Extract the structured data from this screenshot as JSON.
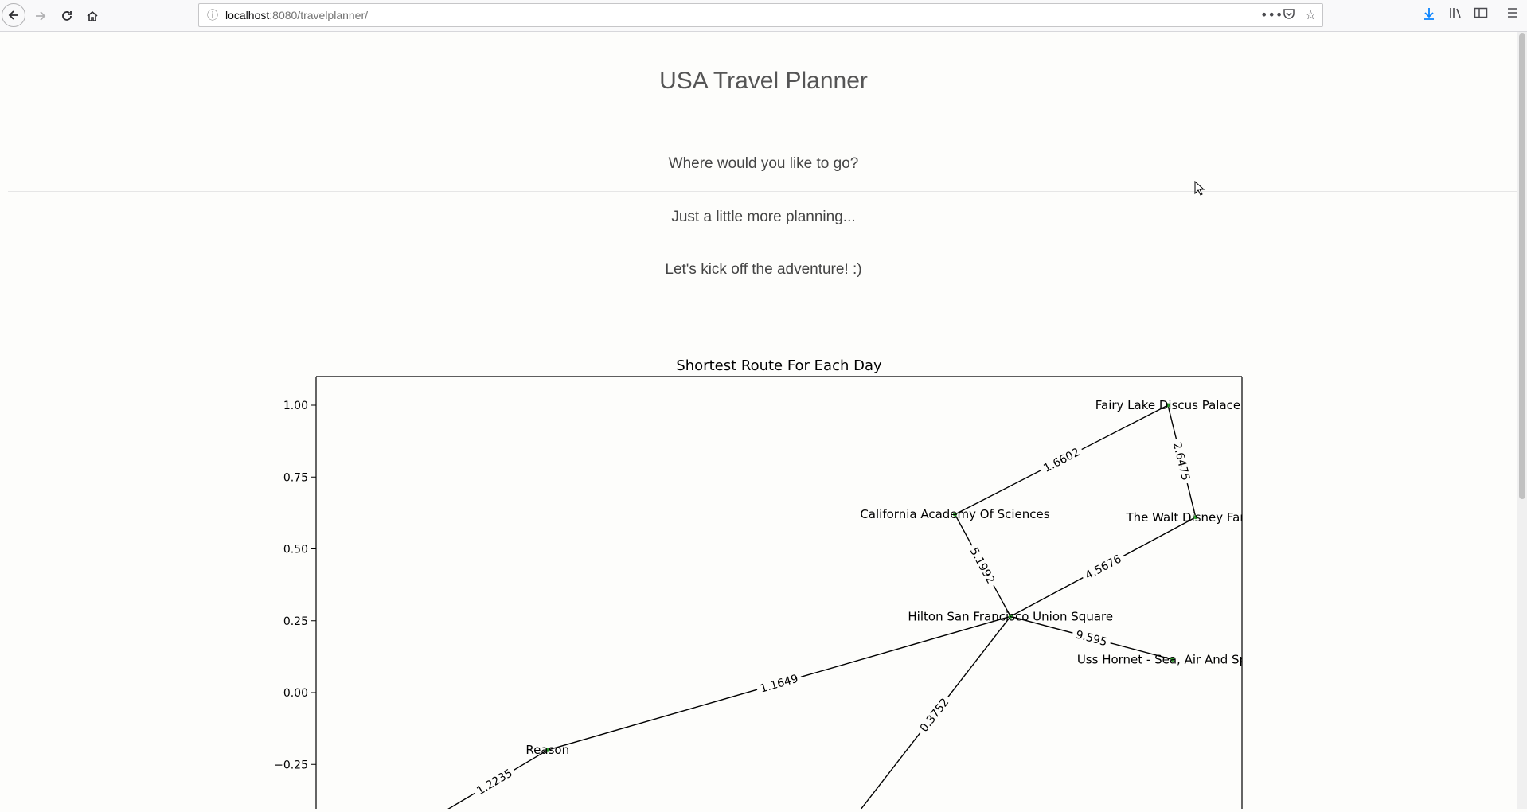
{
  "browser": {
    "url_host": "localhost",
    "url_rest": ":8080/travelplanner/",
    "icons": [
      "back-icon",
      "forward-icon",
      "reload-icon",
      "home-icon",
      "info-icon",
      "more-icon",
      "pocket-icon",
      "bookmark-star-icon",
      "download-icon",
      "library-icon",
      "sidebar-icon",
      "menu-icon"
    ]
  },
  "page": {
    "title": "USA Travel Planner",
    "steps": [
      "Where would you like to go?",
      "Just a little more planning...",
      "Let's kick off the adventure! :)"
    ]
  },
  "chart_data": {
    "type": "network",
    "title": "Shortest Route For Each Day",
    "ylim": [
      -0.42,
      1.19
    ],
    "xlim": [
      -1.0,
      1.0
    ],
    "yticks": [
      "1.00",
      "0.75",
      "0.50",
      "0.25",
      "0.00",
      "−0.25"
    ],
    "ytick_values": [
      1.0,
      0.75,
      0.5,
      0.25,
      0.0,
      -0.25
    ],
    "node_color": "#2ca02c",
    "nodes": [
      {
        "id": "fairy",
        "label": "Fairy Lake Discus Palace",
        "x": 0.84,
        "y": 1.0
      },
      {
        "id": "cas",
        "label": "California Academy Of Sciences",
        "x": 0.38,
        "y": 0.62
      },
      {
        "id": "disney",
        "label": "The Walt Disney Family",
        "x": 0.9,
        "y": 0.61
      },
      {
        "id": "hilton",
        "label": "Hilton San Francisco Union Square",
        "x": 0.5,
        "y": 0.265
      },
      {
        "id": "uss",
        "label": "Uss Hornet - Sea, Air And Space",
        "x": 0.85,
        "y": 0.115
      },
      {
        "id": "reason",
        "label": "Reason",
        "x": -0.5,
        "y": -0.2
      },
      {
        "id": "off1",
        "label": "",
        "x": -0.73,
        "y": -0.42
      },
      {
        "id": "off2",
        "label": "",
        "x": 0.17,
        "y": -0.42
      }
    ],
    "edges": [
      {
        "from": "cas",
        "to": "fairy",
        "label": "1.6602"
      },
      {
        "from": "fairy",
        "to": "disney",
        "label": "2.6475"
      },
      {
        "from": "cas",
        "to": "hilton",
        "label": "5.1992"
      },
      {
        "from": "hilton",
        "to": "disney",
        "label": "4.5676"
      },
      {
        "from": "hilton",
        "to": "uss",
        "label": "9.595"
      },
      {
        "from": "reason",
        "to": "hilton",
        "label": "1.1649"
      },
      {
        "from": "hilton",
        "to": "off2",
        "label": "0.3752"
      },
      {
        "from": "off1",
        "to": "reason",
        "label": "1.2235"
      }
    ]
  }
}
